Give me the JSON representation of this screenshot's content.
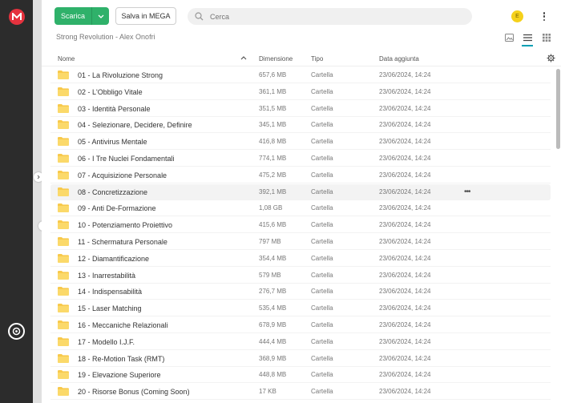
{
  "toolbar": {
    "download_label": "Scarica",
    "save_label": "Salva in MEGA",
    "search_placeholder": "Cerca",
    "avatar_initial": "E"
  },
  "breadcrumb": "Strong Revolution - Alex Onofri",
  "columns": {
    "name": "Nome",
    "size": "Dimensione",
    "type": "Tipo",
    "date": "Data aggiunta"
  },
  "colors": {
    "accent": "#2fb16a",
    "brand": "#e5323e",
    "folder": "#f8c94b",
    "active_view": "#00a0b4"
  },
  "rows": [
    {
      "name": "01 - La Rivoluzione Strong",
      "size": "657,6 MB",
      "type": "Cartella",
      "date": "23/06/2024, 14:24"
    },
    {
      "name": "02 - L'Obbligo Vitale",
      "size": "361,1 MB",
      "type": "Cartella",
      "date": "23/06/2024, 14:24"
    },
    {
      "name": "03 - Identità Personale",
      "size": "351,5 MB",
      "type": "Cartella",
      "date": "23/06/2024, 14:24"
    },
    {
      "name": "04 - Selezionare, Decidere, Definire",
      "size": "345,1 MB",
      "type": "Cartella",
      "date": "23/06/2024, 14:24"
    },
    {
      "name": "05 - Antivirus Mentale",
      "size": "416,8 MB",
      "type": "Cartella",
      "date": "23/06/2024, 14:24"
    },
    {
      "name": "06 - I Tre Nuclei Fondamentali",
      "size": "774,1 MB",
      "type": "Cartella",
      "date": "23/06/2024, 14:24"
    },
    {
      "name": "07 - Acquisizione Personale",
      "size": "475,2 MB",
      "type": "Cartella",
      "date": "23/06/2024, 14:24"
    },
    {
      "name": "08 - Concretizzazione",
      "size": "392,1 MB",
      "type": "Cartella",
      "date": "23/06/2024, 14:24",
      "more": "•••"
    },
    {
      "name": "09 - Anti De-Formazione",
      "size": "1,08 GB",
      "type": "Cartella",
      "date": "23/06/2024, 14:24"
    },
    {
      "name": "10 - Potenziamento Proiettivo",
      "size": "415,6 MB",
      "type": "Cartella",
      "date": "23/06/2024, 14:24"
    },
    {
      "name": "11 - Schermatura Personale",
      "size": "797 MB",
      "type": "Cartella",
      "date": "23/06/2024, 14:24"
    },
    {
      "name": "12 - Diamantificazione",
      "size": "354,4 MB",
      "type": "Cartella",
      "date": "23/06/2024, 14:24"
    },
    {
      "name": "13 - Inarrestabilità",
      "size": "579 MB",
      "type": "Cartella",
      "date": "23/06/2024, 14:24"
    },
    {
      "name": "14 - Indispensabilità",
      "size": "276,7 MB",
      "type": "Cartella",
      "date": "23/06/2024, 14:24"
    },
    {
      "name": "15 - Laser Matching",
      "size": "535,4 MB",
      "type": "Cartella",
      "date": "23/06/2024, 14:24"
    },
    {
      "name": "16 - Meccaniche Relazionali",
      "size": "678,9 MB",
      "type": "Cartella",
      "date": "23/06/2024, 14:24"
    },
    {
      "name": "17 - Modello I.J.F.",
      "size": "444,4 MB",
      "type": "Cartella",
      "date": "23/06/2024, 14:24"
    },
    {
      "name": "18 - Re-Motion Task (RMT)",
      "size": "368,9 MB",
      "type": "Cartella",
      "date": "23/06/2024, 14:24"
    },
    {
      "name": "19 - Elevazione Superiore",
      "size": "448,8 MB",
      "type": "Cartella",
      "date": "23/06/2024, 14:24"
    },
    {
      "name": "20 - Risorse Bonus (Coming Soon)",
      "size": "17 KB",
      "type": "Cartella",
      "date": "23/06/2024, 14:24"
    }
  ]
}
